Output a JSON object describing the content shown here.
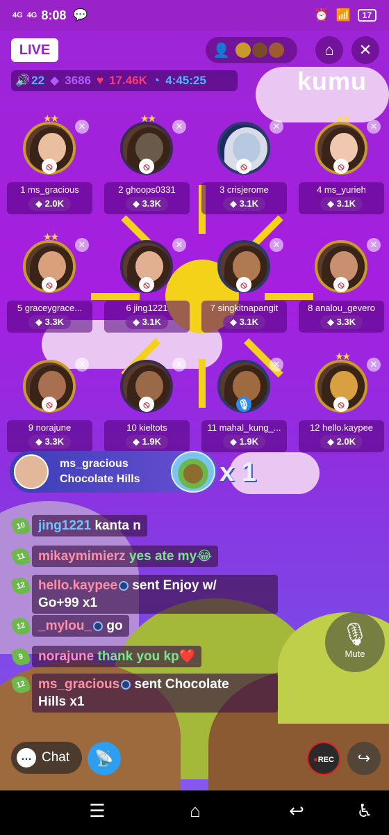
{
  "status_bar": {
    "network1": "4G",
    "network2": "4G",
    "time": "8:08",
    "battery": "17"
  },
  "header": {
    "live_label": "LIVE",
    "brand": "kumu"
  },
  "stats": {
    "viewers": "22",
    "diamonds": "3686",
    "hearts": "17.46K",
    "duration": "4:45:25"
  },
  "seats": [
    {
      "label": "1  ms_gracious",
      "score": "2.0K"
    },
    {
      "label": "2  ghoops0331",
      "score": "3.3K"
    },
    {
      "label": "3  crisjerome",
      "score": "3.1K"
    },
    {
      "label": "4  ms_yurieh",
      "score": "3.1K"
    },
    {
      "label": "5  graceygrace...",
      "score": "3.3K"
    },
    {
      "label": "6  jing1221",
      "score": "3.1K"
    },
    {
      "label": "7  singkitnapangit",
      "score": "3.1K"
    },
    {
      "label": "8  analou_gevero",
      "score": "3.3K"
    },
    {
      "label": "9  norajune",
      "score": "3.3K"
    },
    {
      "label": "10  kieltots",
      "score": "1.9K"
    },
    {
      "label": "11  mahal_kung_...",
      "score": "1.9K"
    },
    {
      "label": "12  hello.kaypee",
      "score": "2.0K"
    }
  ],
  "gift_banner": {
    "user": "ms_gracious",
    "gift": "Chocolate Hills",
    "count": "x 1"
  },
  "chat": [
    {
      "level": "10",
      "user": "jing1221",
      "text": " kanta n"
    },
    {
      "level": "11",
      "user": "mikaymimierz",
      "text": " yes ate my😂"
    },
    {
      "level": "12",
      "user": "hello.kaypee",
      "text": " sent Enjoy w/",
      "text2": "Go+99 x1"
    },
    {
      "level": "12",
      "user": "_mylou_",
      "text": " go"
    },
    {
      "level": "9",
      "user": "norajune",
      "text": " thank you kp❤️"
    },
    {
      "level": "12",
      "user": "ms_gracious",
      "text": " sent Chocolate",
      "text2": "Hills x1"
    }
  ],
  "controls": {
    "mute_label": "Mute",
    "chat_label": "Chat",
    "rec_label": "REC"
  },
  "colors": {
    "accent": "#9b1fcb",
    "diamond": "#b05cff",
    "heart": "#ff3b6b",
    "timer": "#4ab8ff"
  }
}
